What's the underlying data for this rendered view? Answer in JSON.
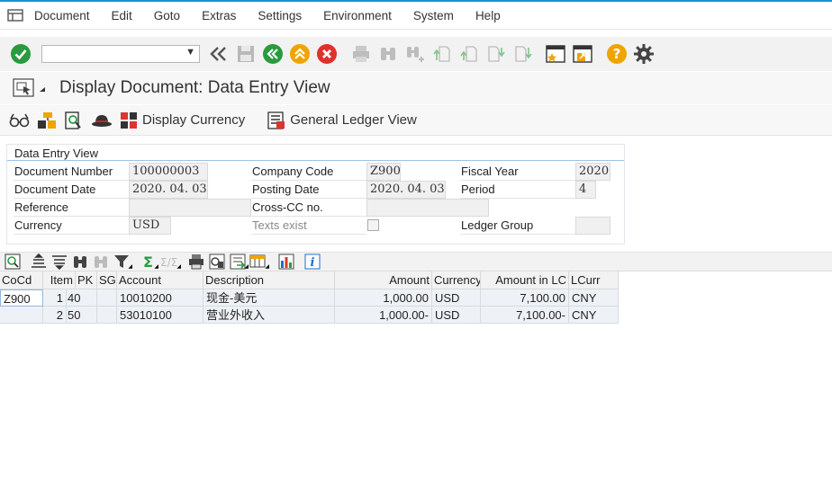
{
  "menu": {
    "items": [
      "Document",
      "Edit",
      "Goto",
      "Extras",
      "Settings",
      "Environment",
      "System",
      "Help"
    ]
  },
  "toolbar": {
    "command_value": "",
    "icons": [
      "enter-icon",
      "back-arrows-icon",
      "save-icon",
      "back-icon",
      "exit-icon",
      "cancel-icon",
      "print-icon",
      "find-icon",
      "find-next-icon",
      "first-page-icon",
      "previous-page-icon",
      "next-page-icon",
      "last-page-icon",
      "new-session-icon",
      "shortcut-icon",
      "help-icon",
      "settings-gear-icon"
    ]
  },
  "title": {
    "text": "Display Document: Data Entry View"
  },
  "app_toolbar": {
    "display_currency": "Display Currency",
    "general_ledger_view": "General Ledger View"
  },
  "header": {
    "section_title": "Data Entry View",
    "document_number_label": "Document Number",
    "document_number": "100000003",
    "company_code_label": "Company Code",
    "company_code": "Z900",
    "fiscal_year_label": "Fiscal Year",
    "fiscal_year": "2020",
    "document_date_label": "Document Date",
    "document_date": "2020. 04. 03",
    "posting_date_label": "Posting Date",
    "posting_date": "2020. 04. 03",
    "period_label": "Period",
    "period": "4",
    "reference_label": "Reference",
    "reference": "",
    "cross_cc_label": "Cross-CC no.",
    "cross_cc": "",
    "currency_label": "Currency",
    "currency": "USD",
    "texts_exist_label": "Texts exist",
    "ledger_group_label": "Ledger Group",
    "ledger_group": ""
  },
  "table": {
    "columns": {
      "cocd": "CoCd",
      "item": "Item",
      "pk": "PK",
      "sg": "SG",
      "account": "Account",
      "description": "Description",
      "amount": "Amount",
      "currency": "Currency",
      "amount_lc": "Amount in LC",
      "lcurr": "LCurr"
    },
    "rows": [
      {
        "cocd": "Z900",
        "item": "1",
        "pk": "40",
        "sg": "",
        "account": "10010200",
        "description": "现金-美元",
        "amount": "1,000.00",
        "currency": "USD",
        "amount_lc": "7,100.00",
        "lcurr": "CNY"
      },
      {
        "cocd": "",
        "item": "2",
        "pk": "50",
        "sg": "",
        "account": "53010100",
        "description": "营业外收入",
        "amount": "1,000.00-",
        "currency": "USD",
        "amount_lc": "7,100.00-",
        "lcurr": "CNY"
      }
    ]
  },
  "colors": {
    "accent": "#1a8fd1",
    "enter_green": "#2a9a3e",
    "cancel_red": "#e0302c",
    "exit_orange": "#f0a400",
    "help_orange": "#f0a400"
  }
}
